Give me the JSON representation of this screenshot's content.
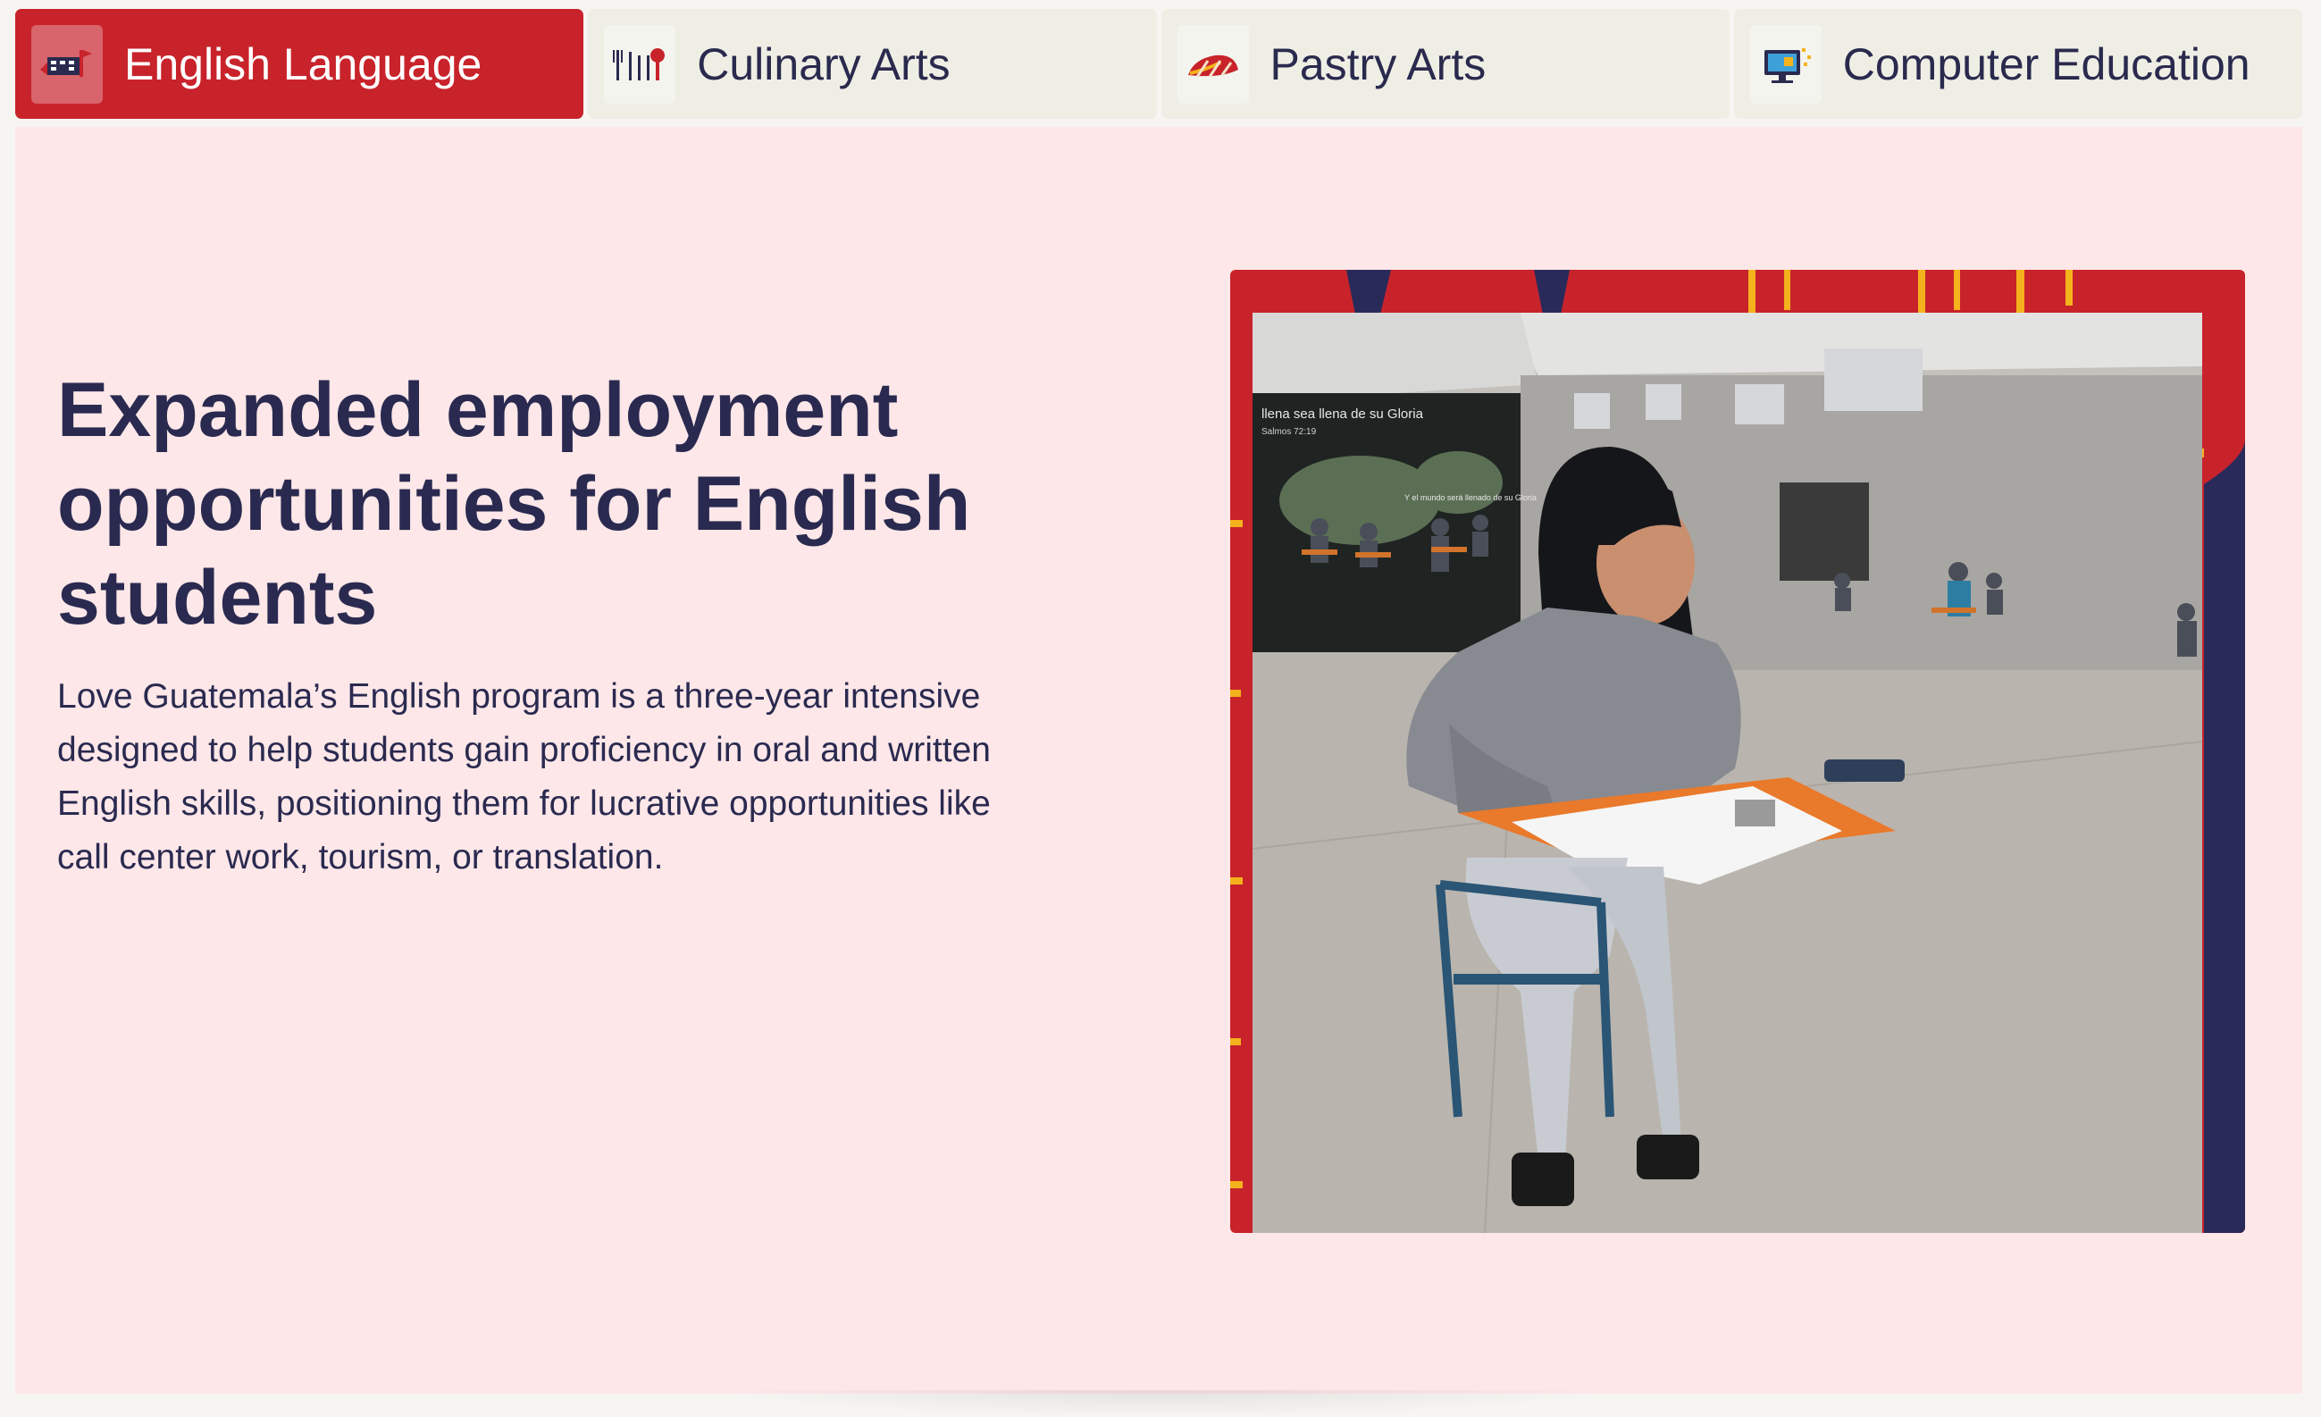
{
  "tabs": [
    {
      "label": "English Language",
      "icon": "english-flag-icon",
      "active": true
    },
    {
      "label": "Culinary Arts",
      "icon": "utensils-icon",
      "active": false
    },
    {
      "label": "Pastry Arts",
      "icon": "pastry-icon",
      "active": false
    },
    {
      "label": "Computer Education",
      "icon": "computer-icon",
      "active": false
    }
  ],
  "content": {
    "headline": "Expanded employment opportunities for English students",
    "description": "Love Guatemala’s English program is a three-year intensive designed to help students gain proficiency in oral and written English skills, positioning them for lucrative opportunities like call center work, tourism, or translation."
  },
  "photo": {
    "wall_text_1": "llena sea llena de su Gloria",
    "wall_text_2": "Salmos 72:19",
    "wall_text_3": "Y el mundo será llenado de su Gloria"
  },
  "colors": {
    "accent_red": "#c8232b",
    "navy": "#2a2a50",
    "panel_bg": "#fde7e8",
    "tab_bg": "#efeee5",
    "frame_yellow": "#f4b21c"
  }
}
